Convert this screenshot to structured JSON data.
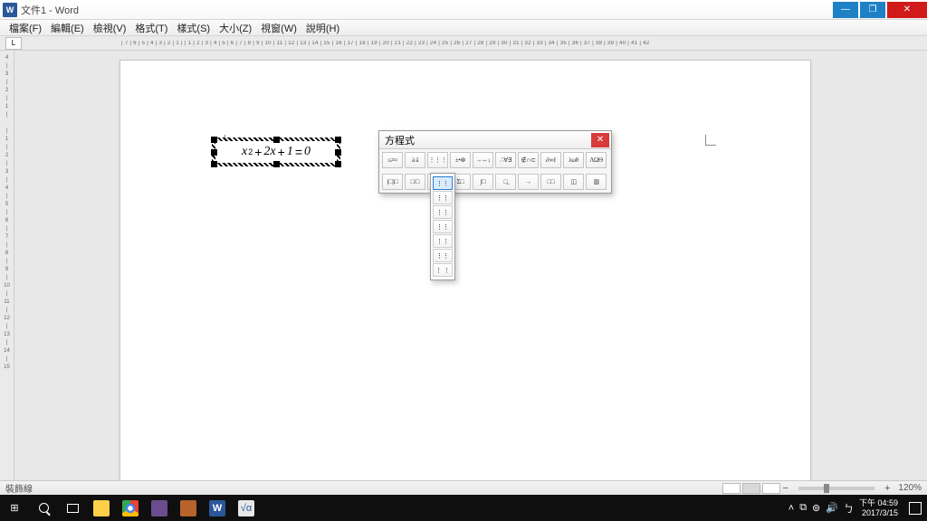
{
  "titlebar": {
    "app_icon": "W",
    "title": "文件1 - Word"
  },
  "menubar": [
    "檔案(F)",
    "編輯(E)",
    "檢視(V)",
    "格式(T)",
    "樣式(S)",
    "大小(Z)",
    "視窗(W)",
    "說明(H)"
  ],
  "ruler_h": "| 7 | 6 | 5 | 4 | 3 | 2 | 1 |     | 1 | 2 | 3 | 4 | 5 | 6 | 7 | 8 | 9 | 10 | 11 | 12 | 13 | 14 | 15 | 16 | 17 | 18 | 19 | 20 | 21 | 22 | 23 | 24 | 25 | 26 | 27 | 28 | 29 | 30 | 31 | 32 | 33 | 34 | 35 | 36 | 37 | 38 | 39 | 40 | 41 | 42",
  "ruler_v": "4\n|\n3\n|\n2\n|\n1\n|\n\n|\n1\n|\n2\n|\n3\n|\n4\n|\n5\n|\n6\n|\n7\n|\n8\n|\n9\n|\n10\n|\n11\n|\n12\n|\n13\n|\n14\n|\n15",
  "equation": {
    "raw": "x^2 + 2x + 1 = 0"
  },
  "eq_toolbar": {
    "title": "方程式",
    "row1": [
      "≤≠≈",
      "ȧ ä",
      "⋮⋮⋮",
      "±•⊗",
      "→⇔↓",
      "∴∀∃",
      "∉∩⊂",
      "∂∞ℓ",
      "λωθ",
      "ΛΩΘ"
    ],
    "row2": [
      "(□)□",
      "□/□",
      "□̄",
      "Σ□",
      "∫□",
      "□̲",
      "→",
      "□□",
      "◫",
      "▥"
    ],
    "dropdown": [
      "⋮⋮",
      "⋮⋮",
      "⋮⋮",
      "⋮⋮",
      "⋮⋮",
      "⋮⋮",
      "⋮ ⋮"
    ]
  },
  "statusbar": {
    "left": "裝飾線",
    "zoom": "120%"
  },
  "taskbar": {
    "clock_time": "下午 04:59",
    "clock_date": "2017/3/15",
    "tray_icons": [
      "▲",
      "db",
      "wifi",
      "vol",
      "ime"
    ]
  }
}
